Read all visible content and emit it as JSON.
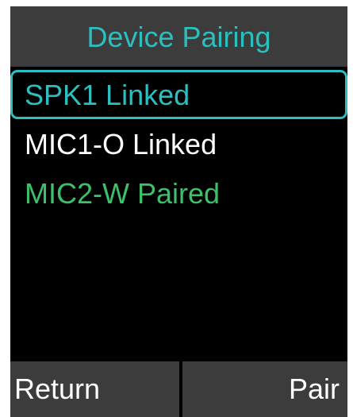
{
  "colors": {
    "accent": "#2dbfbf",
    "paired": "#3cc06a",
    "background": "#000000",
    "bar": "#3c3c3c"
  },
  "header": {
    "title": "Device Pairing"
  },
  "devices": [
    {
      "label": "SPK1 Linked",
      "status": "Linked",
      "selected": true
    },
    {
      "label": "MIC1-O Linked",
      "status": "Linked",
      "selected": false
    },
    {
      "label": "MIC2-W Paired",
      "status": "Paired",
      "selected": false
    }
  ],
  "softkeys": {
    "left_label": "Return",
    "right_label": "Pair"
  }
}
